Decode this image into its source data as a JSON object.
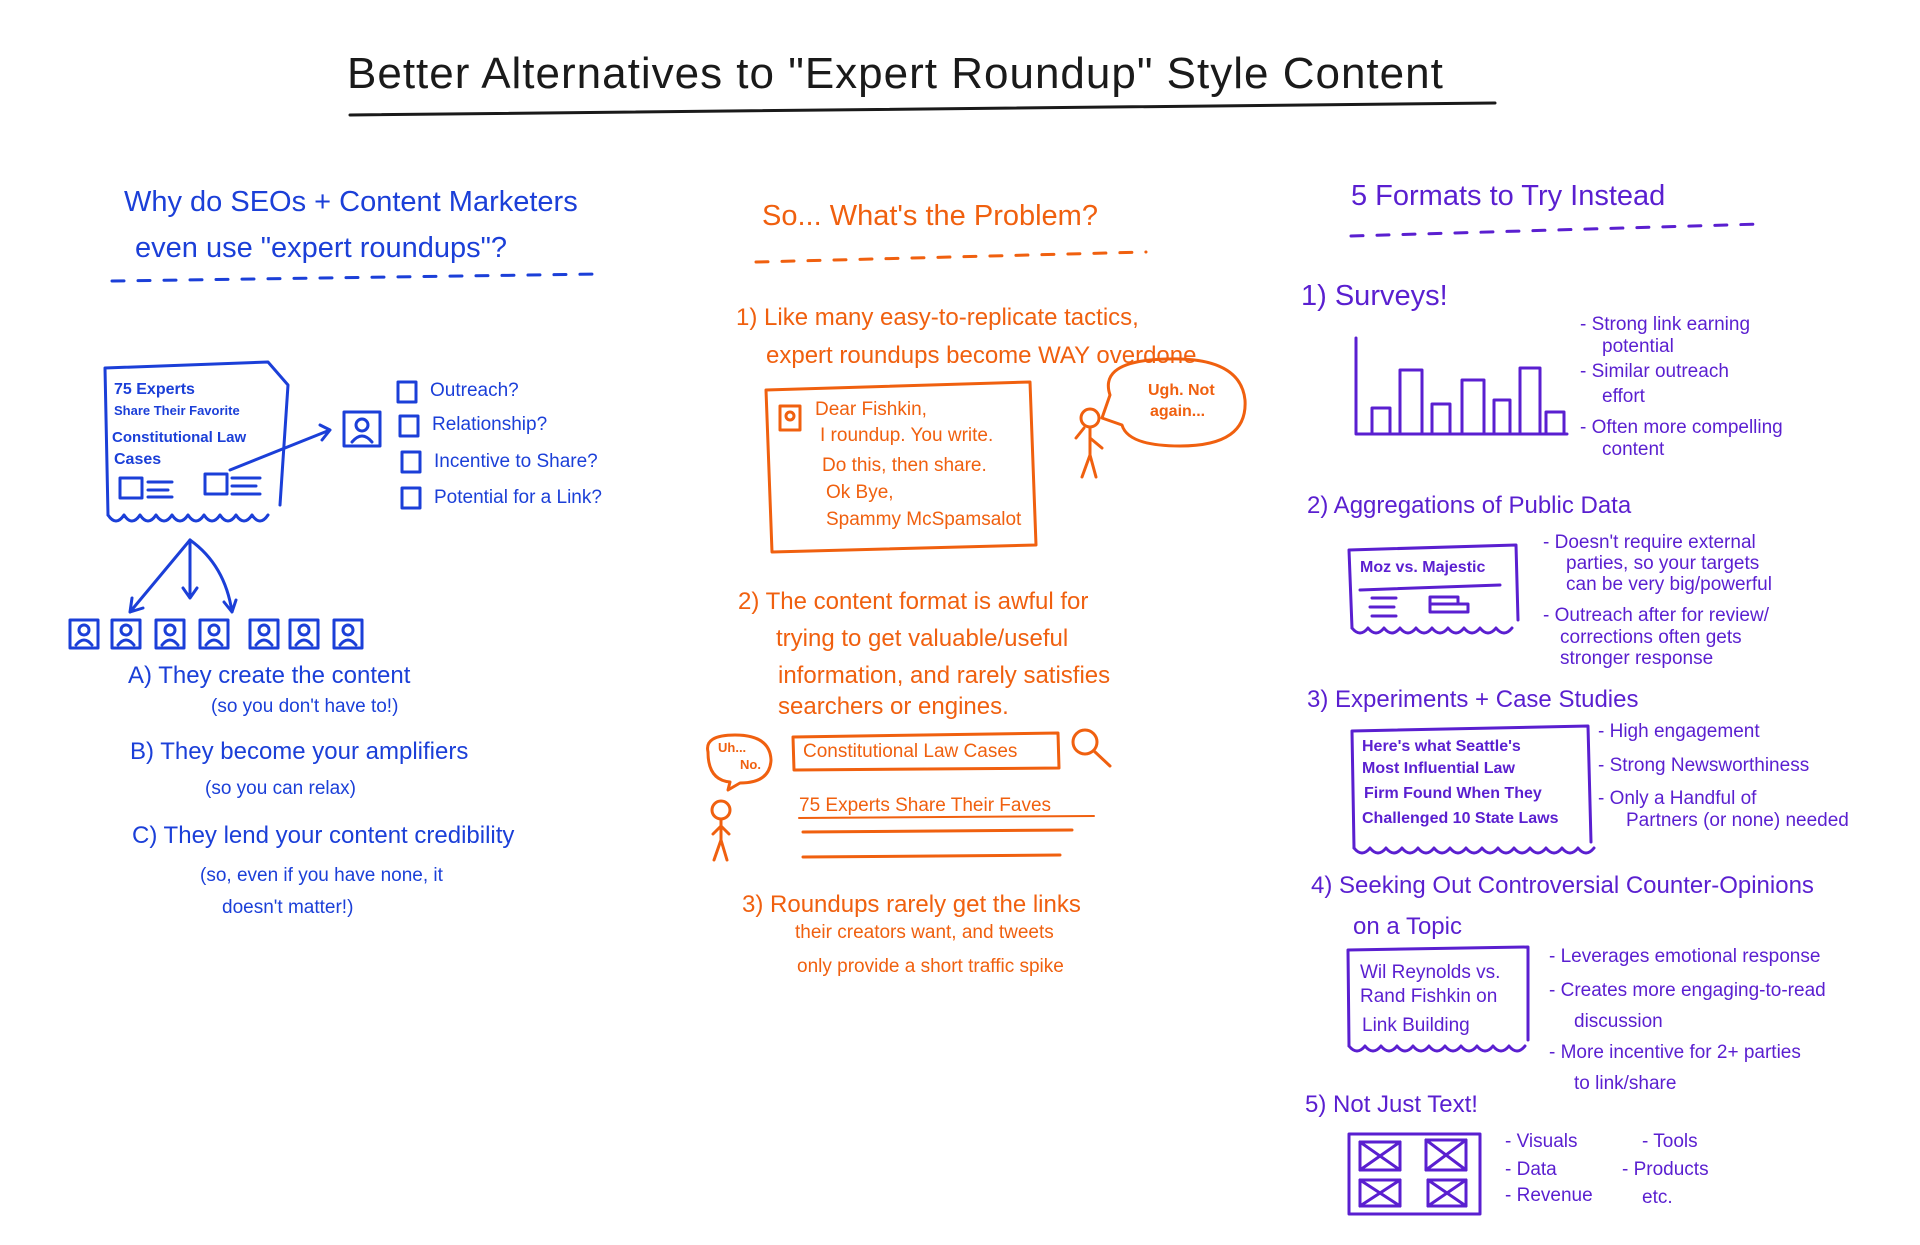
{
  "title": "Better Alternatives to \"Expert Roundup\" Style Content",
  "colors": {
    "left": "#1b3fd8",
    "middle": "#f0600f",
    "right": "#5a1fd0",
    "title": "#1a1a1a"
  },
  "left": {
    "heading": [
      "Why do SEOs + Content Marketers",
      "even use \"expert roundups\"?"
    ],
    "document": [
      "75 Experts",
      "Share Their Favorite",
      "Constitutional Law",
      "Cases"
    ],
    "checklist": [
      "Outreach?",
      "Relationship?",
      "Incentive to Share?",
      "Potential for a Link?"
    ],
    "reasons": [
      {
        "label": "A) They create the content",
        "note": [
          "(so you don't have to!)"
        ]
      },
      {
        "label": "B) They become your amplifiers",
        "note": [
          "(so you can relax)"
        ]
      },
      {
        "label": "C) They lend your content credibility",
        "note": [
          "(so, even if you have none, it",
          "doesn't matter!)"
        ]
      }
    ]
  },
  "middle": {
    "heading": "So... What's the Problem?",
    "problem1": [
      "1) Like many easy-to-replicate tactics,",
      "expert roundups become WAY overdone"
    ],
    "letter": [
      "Dear Fishkin,",
      "I roundup. You write.",
      "Do this, then share.",
      "Ok Bye,",
      "Spammy McSpamsalot"
    ],
    "bubble1": [
      "Ugh. Not",
      "again..."
    ],
    "problem2": [
      "2) The content format is awful for",
      "trying to get valuable/useful",
      "information, and rarely satisfies",
      "searchers or engines."
    ],
    "search_query": "Constitutional Law Cases",
    "search_result": "75 Experts Share Their Faves",
    "bubble2": [
      "Uh...",
      "No."
    ],
    "problem3": [
      "3) Roundups rarely get the links",
      "their creators want, and tweets",
      "only provide a short traffic spike"
    ]
  },
  "right": {
    "heading": "5 Formats to Try Instead",
    "f1": {
      "label": "1) Surveys!",
      "bullets": [
        "- Strong link earning",
        "potential",
        "- Similar outreach",
        "effort",
        "- Often more compelling",
        "content"
      ]
    },
    "f2": {
      "label": "2) Aggregations of Public Data",
      "box": "Moz vs. Majestic",
      "bullets": [
        "- Doesn't require external",
        "parties, so your targets",
        "can be very big/powerful",
        "- Outreach after for review/",
        "corrections often gets",
        "stronger response"
      ]
    },
    "f3": {
      "label": "3) Experiments + Case Studies",
      "box": [
        "Here's what Seattle's",
        "Most Influential Law",
        "Firm Found When They",
        "Challenged 10 State Laws"
      ],
      "bullets": [
        "- High engagement",
        "- Strong Newsworthiness",
        "- Only a Handful of",
        "Partners (or none) needed"
      ]
    },
    "f4": {
      "label": "4) Seeking Out Controversial Counter-Opinions",
      "label2": "on a Topic",
      "box": [
        "Wil Reynolds vs.",
        "Rand Fishkin on",
        "Link Building"
      ],
      "bullets": [
        "- Leverages emotional response",
        "- Creates more engaging-to-read",
        "discussion",
        "- More incentive for 2+ parties",
        "to link/share"
      ]
    },
    "f5": {
      "label": "5) Not Just Text!",
      "bullets_a": [
        "- Visuals",
        "- Data",
        "- Revenue"
      ],
      "bullets_b": [
        "- Tools",
        "- Products",
        "etc."
      ]
    }
  }
}
